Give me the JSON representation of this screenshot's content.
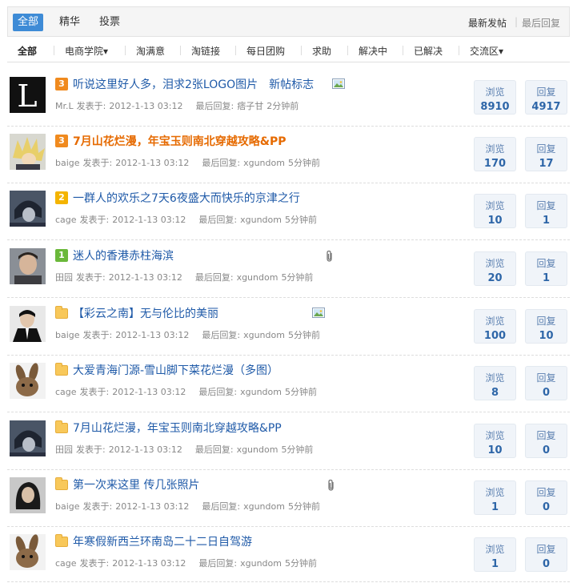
{
  "top_tabs": [
    "全部",
    "精华",
    "投票"
  ],
  "sort_links": {
    "latest_post": "最新发帖",
    "separator": "|",
    "latest_reply": "最后回复"
  },
  "sub_nav": [
    "全部",
    "电商学院▾",
    "淘满意",
    "淘链接",
    "每日团购",
    "求助",
    "解决中",
    "已解决",
    "交流区▾"
  ],
  "stat_labels": {
    "views": "浏览",
    "replies": "回复"
  },
  "meta_labels": {
    "posted": "发表于:",
    "last_reply": "最后回复:"
  },
  "threads": [
    {
      "badge": "3",
      "badge_color": "orange",
      "title": "听说这里好人多，泪求2张LOGO图片",
      "extra_tag": "新帖标志",
      "attachment": "image-icon",
      "author": "Mr.L",
      "posted": "2012-1-13 03:12",
      "last_user": "痞子甘",
      "last_time": "2分钟前",
      "views": "8910",
      "replies": "4917",
      "hot": false
    },
    {
      "badge": "3",
      "badge_color": "orange",
      "title": "7月山花烂漫，年宝玉则南北穿越攻略&PP",
      "extra_tag": "",
      "attachment": "",
      "author": "baige",
      "posted": "2012-1-13 03:12",
      "last_user": "xgundom",
      "last_time": "5分钟前",
      "views": "170",
      "replies": "17",
      "hot": true
    },
    {
      "badge": "2",
      "badge_color": "yellow",
      "title": "一群人的欢乐之7天6夜盛大而快乐的京津之行",
      "extra_tag": "",
      "attachment": "",
      "author": "cage",
      "posted": "2012-1-13 03:12",
      "last_user": "xgundom",
      "last_time": "5分钟前",
      "views": "10",
      "replies": "1",
      "hot": false
    },
    {
      "badge": "1",
      "badge_color": "green",
      "title": "迷人的香港赤柱海滨",
      "extra_tag": "",
      "attachment": "paperclip-icon",
      "author": "田园",
      "posted": "2012-1-13 03:12",
      "last_user": "xgundom",
      "last_time": "5分钟前",
      "views": "20",
      "replies": "1",
      "hot": false
    },
    {
      "badge": "",
      "badge_color": "folder",
      "title": "【彩云之南】无与伦比的美丽",
      "extra_tag": "",
      "attachment": "image-icon",
      "author": "baige",
      "posted": "2012-1-13 03:12",
      "last_user": "xgundom",
      "last_time": "5分钟前",
      "views": "100",
      "replies": "10",
      "hot": false
    },
    {
      "badge": "",
      "badge_color": "folder",
      "title": "大爱青海门源-雪山脚下菜花烂漫（多图）",
      "extra_tag": "",
      "attachment": "",
      "author": "cage",
      "posted": "2012-1-13 03:12",
      "last_user": "xgundom",
      "last_time": "5分钟前",
      "views": "8",
      "replies": "0",
      "hot": false
    },
    {
      "badge": "",
      "badge_color": "folder",
      "title": "7月山花烂漫，年宝玉则南北穿越攻略&PP",
      "extra_tag": "",
      "attachment": "",
      "author": "田园",
      "posted": "2012-1-13 03:12",
      "last_user": "xgundom",
      "last_time": "5分钟前",
      "views": "10",
      "replies": "0",
      "hot": false
    },
    {
      "badge": "",
      "badge_color": "folder",
      "title": "第一次来这里 传几张照片",
      "extra_tag": "",
      "attachment": "paperclip-icon",
      "author": "baige",
      "posted": "2012-1-13 03:12",
      "last_user": "xgundom",
      "last_time": "5分钟前",
      "views": "1",
      "replies": "0",
      "hot": false
    },
    {
      "badge": "",
      "badge_color": "folder",
      "title": "年寒假新西兰环南岛二十二日自驾游",
      "extra_tag": "",
      "attachment": "",
      "author": "cage",
      "posted": "2012-1-13 03:12",
      "last_user": "xgundom",
      "last_time": "5分钟前",
      "views": "1",
      "replies": "0",
      "hot": false
    }
  ]
}
